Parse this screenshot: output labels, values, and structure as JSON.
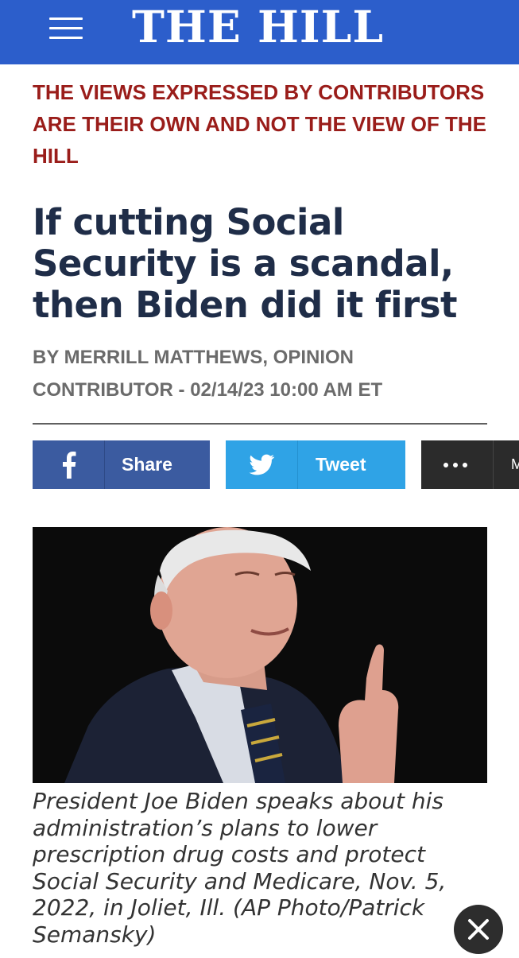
{
  "header": {
    "logo": "THE HILL",
    "background": "#2c5ecb",
    "menu_icon": "hamburger-menu-icon"
  },
  "article": {
    "disclaimer": "THE VIEWS EXPRESSED BY CONTRIBUTORS ARE THEIR OWN AND NOT THE VIEW OF THE HILL",
    "headline": "If cutting Social Security is a scandal, then Biden did it first",
    "byline": "BY MERRILL MATTHEWS, OPINION CONTRIBUTOR - 02/14/23 10:00 AM ET",
    "image_caption": "President Joe Biden speaks about his administration’s plans to lower prescription drug costs and protect Social Security and Medicare, Nov. 5, 2022, in Joliet, Ill. (AP Photo/Patrick Semansky)"
  },
  "share": {
    "facebook_label": "Share",
    "twitter_label": "Tweet",
    "more_label": "M",
    "facebook_color": "#3b5ba0",
    "twitter_color": "#2fa3e6",
    "more_color": "#2b2b2b",
    "facebook_icon": "facebook-icon",
    "twitter_icon": "twitter-icon",
    "more_icon": "more-dots-icon"
  },
  "overlay": {
    "close_icon": "close-icon"
  },
  "colors": {
    "disclaimer": "#9a1d1a",
    "headline": "#1f2d48",
    "byline": "#6b6b6b"
  }
}
